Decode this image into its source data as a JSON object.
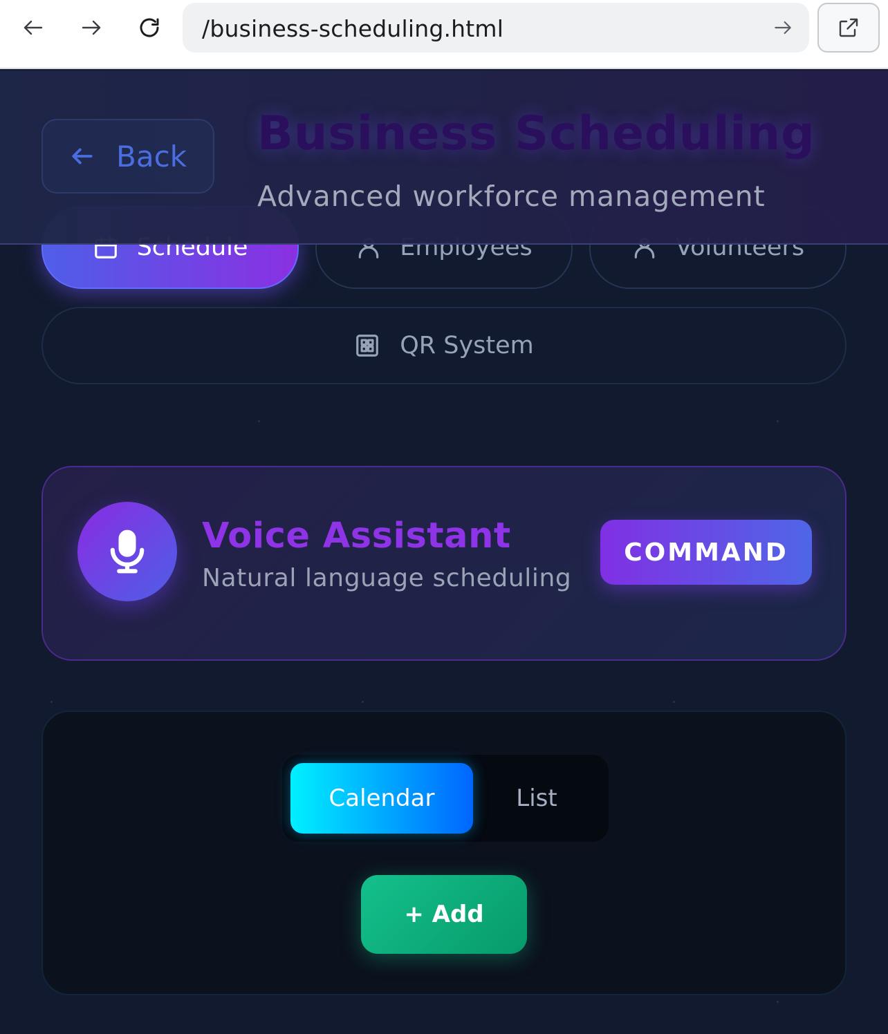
{
  "browser": {
    "url": "/business-scheduling.html"
  },
  "header": {
    "back_label": "Back",
    "title": "Business Scheduling",
    "subtitle": "Advanced workforce management"
  },
  "tabs": [
    {
      "label": "Schedule",
      "icon": "calendar-icon",
      "active": true
    },
    {
      "label": "Employees",
      "icon": "user-icon",
      "active": false
    },
    {
      "label": "Volunteers",
      "icon": "volunteer-icon",
      "active": false
    },
    {
      "label": "QR System",
      "icon": "qr-icon",
      "active": false
    }
  ],
  "voice": {
    "title": "Voice Assistant",
    "subtitle": "Natural language scheduling",
    "command_label": "COMMAND"
  },
  "schedule": {
    "views": [
      "Calendar",
      "List"
    ],
    "active_view": "Calendar",
    "add_label": "+ Add"
  },
  "colors": {
    "background": "#111a2e",
    "accent_purple": "#8a2be2",
    "accent_blue": "#4f5ee8",
    "calendar_cyan": "#00f0ff",
    "add_green": "#14c08c"
  }
}
